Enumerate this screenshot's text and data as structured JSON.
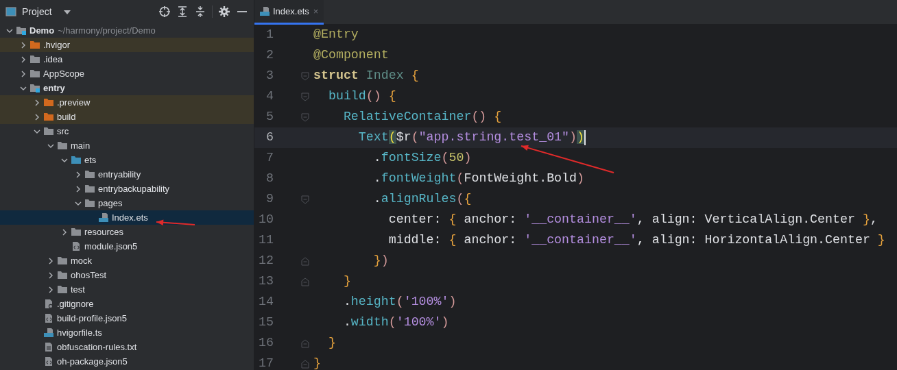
{
  "project_panel": {
    "title": "Project",
    "tree": [
      {
        "label": "Demo",
        "kind": "module",
        "path": "~/harmony/project/Demo",
        "expanded": true,
        "children": [
          {
            "label": ".hvigor",
            "kind": "folder",
            "excluded": true,
            "expanded": false
          },
          {
            "label": ".idea",
            "kind": "folder",
            "expanded": false
          },
          {
            "label": "AppScope",
            "kind": "folder",
            "expanded": false
          },
          {
            "label": "entry",
            "kind": "module",
            "expanded": true,
            "children": [
              {
                "label": ".preview",
                "kind": "folder",
                "excluded": true,
                "expanded": false
              },
              {
                "label": "build",
                "kind": "folder",
                "excluded": true,
                "expanded": false
              },
              {
                "label": "src",
                "kind": "folder",
                "expanded": true,
                "children": [
                  {
                    "label": "main",
                    "kind": "folder",
                    "expanded": true,
                    "children": [
                      {
                        "label": "ets",
                        "kind": "source",
                        "expanded": true,
                        "children": [
                          {
                            "label": "entryability",
                            "kind": "folder",
                            "expanded": false
                          },
                          {
                            "label": "entrybackupability",
                            "kind": "folder",
                            "expanded": false
                          },
                          {
                            "label": "pages",
                            "kind": "folder",
                            "expanded": true,
                            "children": [
                              {
                                "label": "Index.ets",
                                "kind": "ets",
                                "selected": true
                              }
                            ]
                          }
                        ]
                      },
                      {
                        "label": "resources",
                        "kind": "folder",
                        "expanded": false
                      },
                      {
                        "label": "module.json5",
                        "kind": "json",
                        "selected": false
                      }
                    ]
                  },
                  {
                    "label": "mock",
                    "kind": "folder",
                    "expanded": false
                  },
                  {
                    "label": "ohosTest",
                    "kind": "folder",
                    "expanded": false
                  },
                  {
                    "label": "test",
                    "kind": "folder",
                    "expanded": false
                  }
                ]
              },
              {
                "label": ".gitignore",
                "kind": "ignore",
                "selected": false
              },
              {
                "label": "build-profile.json5",
                "kind": "json",
                "selected": false
              },
              {
                "label": "hvigorfile.ts",
                "kind": "ts",
                "selected": false
              },
              {
                "label": "obfuscation-rules.txt",
                "kind": "txt",
                "selected": false
              },
              {
                "label": "oh-package.json5",
                "kind": "json",
                "selected": false
              }
            ]
          }
        ]
      }
    ]
  },
  "editor": {
    "tabs": [
      {
        "label": "Index.ets",
        "close": "×",
        "selected": true
      }
    ],
    "lines": [
      {
        "number": "1",
        "kind": "plain",
        "tokens": [
          {
            "text": "@Entry",
            "kind": "annotation"
          }
        ]
      },
      {
        "number": "2",
        "kind": "plain",
        "tokens": [
          {
            "text": "@Component",
            "kind": "annotation"
          }
        ]
      },
      {
        "number": "3",
        "kind": "fold_start",
        "tokens": [
          {
            "text": "struct",
            "kind": "keyword"
          },
          {
            "text": " Index",
            "kind": "type"
          },
          {
            "text": " {",
            "kind": "brace"
          }
        ]
      },
      {
        "number": "4",
        "kind": "fold_start",
        "tokens": [
          {
            "text": "  build",
            "kind": "func"
          },
          {
            "text": "()",
            "kind": "paren"
          },
          {
            "text": " {",
            "kind": "brace"
          }
        ]
      },
      {
        "number": "5",
        "kind": "fold_start",
        "tokens": [
          {
            "text": "    RelativeContainer",
            "kind": "func"
          },
          {
            "text": "()",
            "kind": "paren"
          },
          {
            "text": " {",
            "kind": "brace"
          }
        ]
      },
      {
        "number": "6",
        "kind": "plain",
        "current": true,
        "tokens": [
          {
            "text": "      Text",
            "kind": "func"
          },
          {
            "text": "(",
            "kind": "paren",
            "matched": true
          },
          {
            "text": "$r",
            "kind": "plain"
          },
          {
            "text": "(",
            "kind": "paren"
          },
          {
            "text": "\"app.string.test_01\"",
            "kind": "string"
          },
          {
            "text": ")",
            "kind": "paren"
          },
          {
            "text": ")",
            "kind": "paren",
            "matched": true
          }
        ]
      },
      {
        "number": "7",
        "kind": "plain",
        "tokens": [
          {
            "text": "        .",
            "kind": "plain"
          },
          {
            "text": "fontSize",
            "kind": "func"
          },
          {
            "text": "(",
            "kind": "paren"
          },
          {
            "text": "50",
            "kind": "number"
          },
          {
            "text": ")",
            "kind": "paren"
          }
        ]
      },
      {
        "number": "8",
        "kind": "plain",
        "tokens": [
          {
            "text": "        .",
            "kind": "plain"
          },
          {
            "text": "fontWeight",
            "kind": "func"
          },
          {
            "text": "(",
            "kind": "paren"
          },
          {
            "text": "FontWeight.Bold",
            "kind": "plain"
          },
          {
            "text": ")",
            "kind": "paren"
          }
        ]
      },
      {
        "number": "9",
        "kind": "fold_start",
        "tokens": [
          {
            "text": "        .",
            "kind": "plain"
          },
          {
            "text": "alignRules",
            "kind": "func"
          },
          {
            "text": "(",
            "kind": "paren"
          },
          {
            "text": "{",
            "kind": "brace"
          }
        ]
      },
      {
        "number": "10",
        "kind": "plain",
        "tokens": [
          {
            "text": "          center: ",
            "kind": "plain"
          },
          {
            "text": "{",
            "kind": "brace"
          },
          {
            "text": " anchor: ",
            "kind": "plain"
          },
          {
            "text": "'__container__'",
            "kind": "string"
          },
          {
            "text": ", align: VerticalAlign.Center ",
            "kind": "plain"
          },
          {
            "text": "}",
            "kind": "brace"
          },
          {
            "text": ",",
            "kind": "plain"
          }
        ]
      },
      {
        "number": "11",
        "kind": "plain",
        "tokens": [
          {
            "text": "          middle: ",
            "kind": "plain"
          },
          {
            "text": "{",
            "kind": "brace"
          },
          {
            "text": " anchor: ",
            "kind": "plain"
          },
          {
            "text": "'__container__'",
            "kind": "string"
          },
          {
            "text": ", align: HorizontalAlign.Center ",
            "kind": "plain"
          },
          {
            "text": "}",
            "kind": "brace"
          }
        ]
      },
      {
        "number": "12",
        "kind": "fold_end",
        "tokens": [
          {
            "text": "        }",
            "kind": "brace"
          },
          {
            "text": ")",
            "kind": "paren"
          }
        ]
      },
      {
        "number": "13",
        "kind": "fold_end",
        "tokens": [
          {
            "text": "    }",
            "kind": "brace"
          }
        ]
      },
      {
        "number": "14",
        "kind": "plain",
        "tokens": [
          {
            "text": "    .",
            "kind": "plain"
          },
          {
            "text": "height",
            "kind": "func"
          },
          {
            "text": "(",
            "kind": "paren"
          },
          {
            "text": "'100%'",
            "kind": "string"
          },
          {
            "text": ")",
            "kind": "paren"
          }
        ]
      },
      {
        "number": "15",
        "kind": "plain",
        "tokens": [
          {
            "text": "    .",
            "kind": "plain"
          },
          {
            "text": "width",
            "kind": "func"
          },
          {
            "text": "(",
            "kind": "paren"
          },
          {
            "text": "'100%'",
            "kind": "string"
          },
          {
            "text": ")",
            "kind": "paren"
          }
        ]
      },
      {
        "number": "16",
        "kind": "fold_end",
        "tokens": [
          {
            "text": "  }",
            "kind": "brace"
          }
        ]
      },
      {
        "number": "17",
        "kind": "fold_end",
        "tokens": [
          {
            "text": "}",
            "kind": "brace"
          }
        ]
      }
    ]
  }
}
